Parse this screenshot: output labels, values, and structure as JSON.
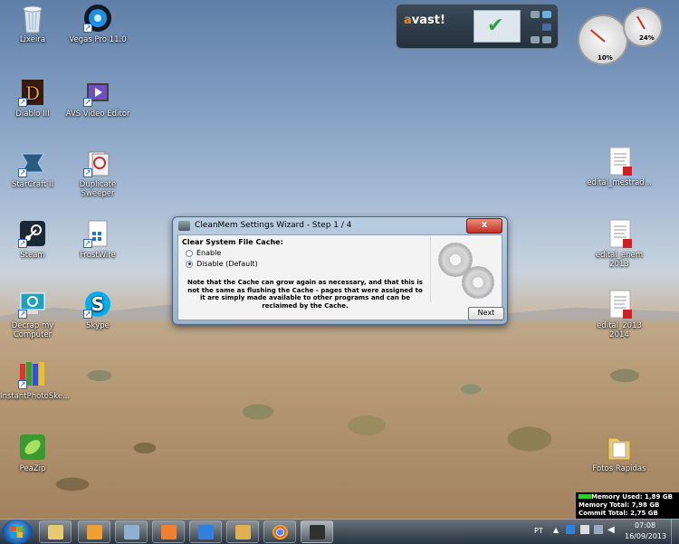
{
  "desktop": {
    "icons": [
      {
        "label": "Lixeira"
      },
      {
        "label": "Vegas Pro 11.0"
      },
      {
        "label": "Diablo III"
      },
      {
        "label": "AVS Video Editor"
      },
      {
        "label": "StarCraft II"
      },
      {
        "label": "Duplicate Sweeper"
      },
      {
        "label": "Steam"
      },
      {
        "label": "FrostWire"
      },
      {
        "label": "Decrap my Computer"
      },
      {
        "label": "Skype"
      },
      {
        "label": "InstantPhotoSke..."
      },
      {
        "label": "PeaZip"
      },
      {
        "label": "edital_mestrad..."
      },
      {
        "label": "edital_enem 2013"
      },
      {
        "label": "edital_2013 2014"
      },
      {
        "label": "Fotos Rapidas"
      }
    ]
  },
  "avast": {
    "logo_prefix": "a",
    "logo_rest": "vast!"
  },
  "gauges": {
    "cpu_label": "10%",
    "ram_label": "24%"
  },
  "dialog": {
    "title": "CleanMem Settings Wizard - Step 1 / 4",
    "close_label": "x",
    "heading": "Clear System File Cache:",
    "options": [
      {
        "label": "Enable",
        "selected": false
      },
      {
        "label": "Disable (Default)",
        "selected": true
      }
    ],
    "note": "Note that the Cache can grow again as necessary, and that this is not the same as flushing the Cache - pages that were assigned to it are simply made available to other programs and can be reclaimed by the Cache.",
    "next_label": "Next"
  },
  "memory_widget": {
    "used": "Memory Used: 1,89 GB",
    "total": "Memory Total: 7,98 GB",
    "commit": "Commit Total: 2,75 GB"
  },
  "taskbar": {
    "language": "PT",
    "time": "07:08",
    "date": "16/09/2013"
  },
  "colors": {
    "accent": "#1a60b0",
    "avast_orange": "#f08a18",
    "check_green": "#2aa040"
  }
}
